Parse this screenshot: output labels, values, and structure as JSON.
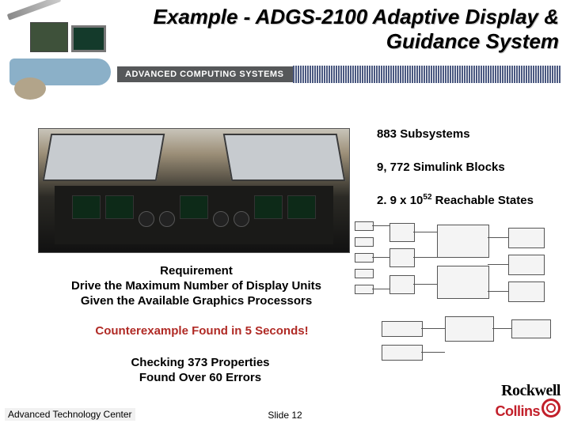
{
  "title_line1": "Example - ADGS-2100 Adaptive Display &",
  "title_line2": "Guidance System",
  "banner_label": "ADVANCED COMPUTING SYSTEMS",
  "stats": {
    "subsystems": "883 Subsystems",
    "blocks": "9, 772 Simulink Blocks",
    "states_prefix": "2. 9 x 10",
    "states_exp": "52",
    "states_suffix": " Reachable States"
  },
  "requirement": {
    "heading": "Requirement",
    "line1": "Drive the Maximum Number of Display Units",
    "line2": "Given the Available Graphics Processors"
  },
  "counterexample": "Counterexample Found in 5 Seconds!",
  "checking": {
    "line1": "Checking 373 Properties",
    "line2": "Found Over 60 Errors"
  },
  "footer": {
    "left": "Advanced Technology Center",
    "center": "Slide 12"
  },
  "logo": {
    "line1": "Rockwell",
    "line2": "Collins"
  }
}
